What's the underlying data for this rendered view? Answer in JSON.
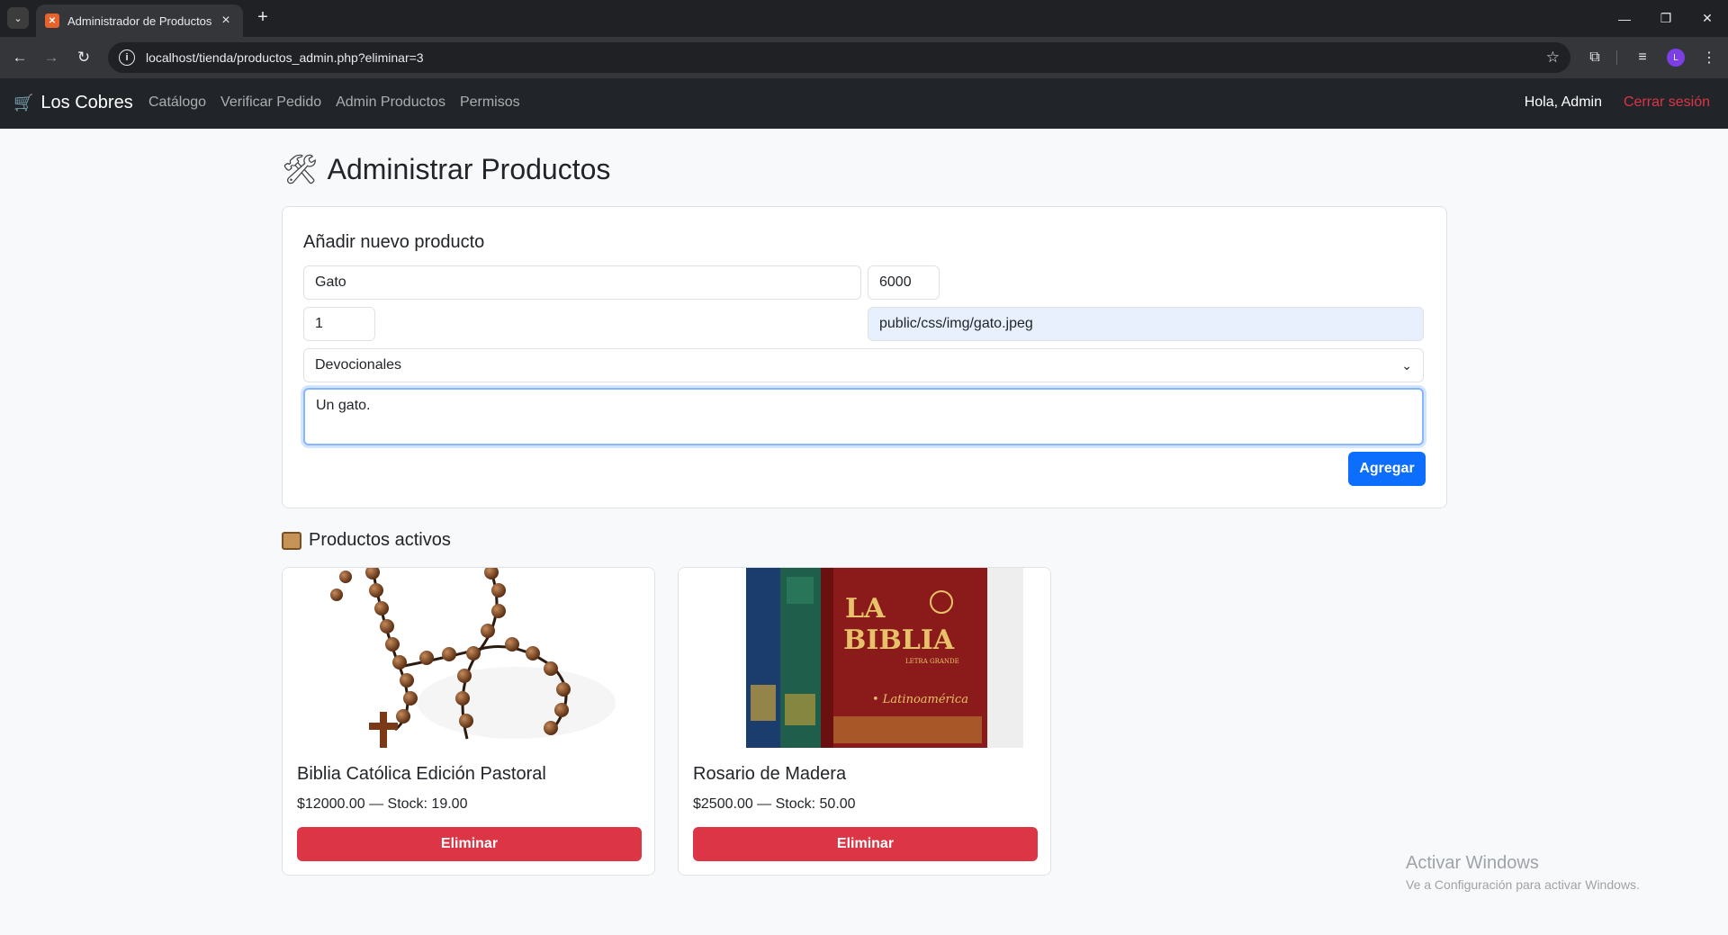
{
  "browser": {
    "tab_title": "Administrador de Productos",
    "url": "localhost/tienda/productos_admin.php?eliminar=3",
    "profile_initial": "L"
  },
  "navbar": {
    "brand": "Los Cobres",
    "links": [
      "Catálogo",
      "Verificar Pedido",
      "Admin Productos",
      "Permisos"
    ],
    "greeting": "Hola, Admin",
    "logout": "Cerrar sesión"
  },
  "page": {
    "title": "Administrar Productos"
  },
  "form": {
    "title": "Añadir nuevo producto",
    "name_value": "Gato",
    "price_value": "6000",
    "stock_value": "1",
    "image_value": "public/css/img/gato.jpeg",
    "category_value": "Devocionales",
    "description_value": "Un gato.",
    "submit_label": "Agregar"
  },
  "products": {
    "section_title": "Productos activos",
    "items": [
      {
        "name": "Biblia Católica Edición Pastoral",
        "meta": "$12000.00 — Stock: 19.00",
        "delete_label": "Eliminar"
      },
      {
        "name": "Rosario de Madera",
        "meta": "$2500.00 — Stock: 50.00",
        "delete_label": "Eliminar",
        "book_title_line1": "LA",
        "book_title_line2": "BIBLIA",
        "book_subtitle": "LETRA GRANDE",
        "book_edition": "• Latinoamérica"
      }
    ]
  },
  "watermark": {
    "line1": "Activar Windows",
    "line2": "Ve a Configuración para activar Windows."
  },
  "colors": {
    "primary": "#0d6efd",
    "danger": "#dc3545",
    "navbar_bg": "#212529"
  }
}
